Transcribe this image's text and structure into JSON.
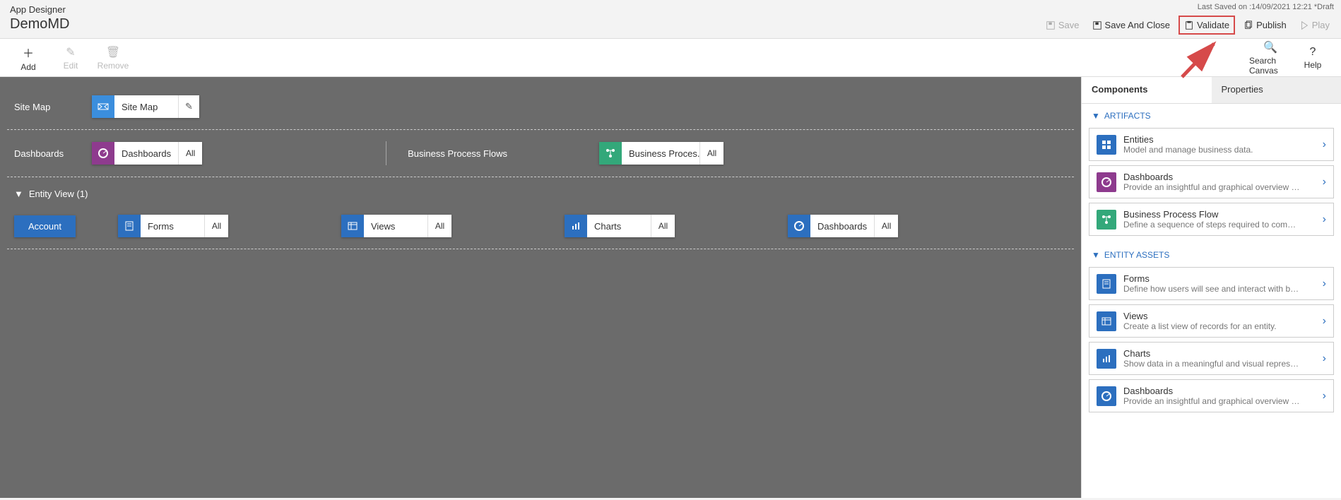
{
  "header": {
    "app_title": "App Designer",
    "app_name": "DemoMD",
    "last_saved": "Last Saved on :14/09/2021 12:21 *Draft",
    "actions": {
      "save": "Save",
      "save_and_close": "Save And Close",
      "validate": "Validate",
      "publish": "Publish",
      "play": "Play"
    }
  },
  "toolbar": {
    "add": "Add",
    "edit": "Edit",
    "remove": "Remove",
    "search": "Search Canvas",
    "help": "Help"
  },
  "canvas": {
    "sitemap_label": "Site Map",
    "sitemap_card": "Site Map",
    "dashboards_label": "Dashboards",
    "dashboards_card": "Dashboards",
    "dashboards_count": "All",
    "bpf_label": "Business Process Flows",
    "bpf_card": "Business Proces...",
    "bpf_count": "All",
    "entity_view_label": "Entity View (1)",
    "account_label": "Account",
    "forms": "Forms",
    "forms_count": "All",
    "views": "Views",
    "views_count": "All",
    "charts": "Charts",
    "charts_count": "All",
    "ent_dashboards": "Dashboards",
    "ent_dashboards_count": "All"
  },
  "sidebar": {
    "tabs": {
      "components": "Components",
      "properties": "Properties"
    },
    "sections": {
      "artifacts": "ARTIFACTS",
      "entity_assets": "ENTITY ASSETS"
    },
    "artifacts": [
      {
        "title": "Entities",
        "desc": "Model and manage business data.",
        "color": "#2c6fbf"
      },
      {
        "title": "Dashboards",
        "desc": "Provide an insightful and graphical overview of bu...",
        "color": "#8e3b8e"
      },
      {
        "title": "Business Process Flow",
        "desc": "Define a sequence of steps required to complete ...",
        "color": "#33a87a"
      }
    ],
    "assets": [
      {
        "title": "Forms",
        "desc": "Define how users will see and interact with busine...",
        "color": "#2c6fbf"
      },
      {
        "title": "Views",
        "desc": "Create a list view of records for an entity.",
        "color": "#2c6fbf"
      },
      {
        "title": "Charts",
        "desc": "Show data in a meaningful and visual representati...",
        "color": "#2c6fbf"
      },
      {
        "title": "Dashboards",
        "desc": "Provide an insightful and graphical overview of bu...",
        "color": "#2c6fbf"
      }
    ]
  }
}
